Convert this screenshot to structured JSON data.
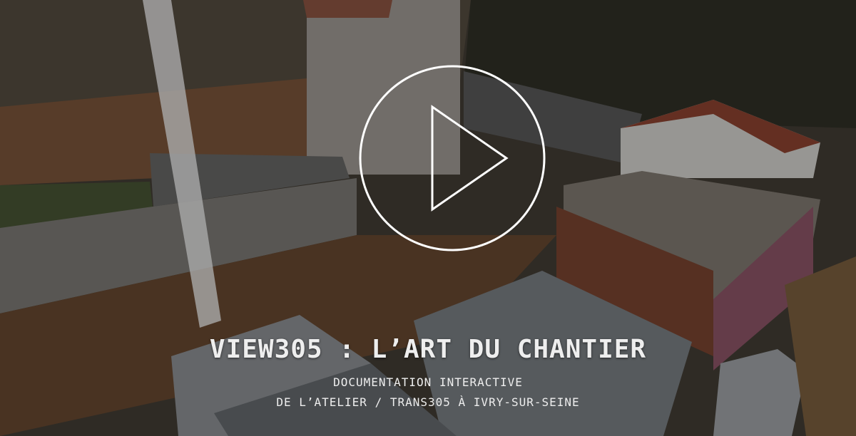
{
  "video": {
    "title": "VIEW305 : L’ART DU CHANTIER",
    "subtitle_line1": "DOCUMENTATION INTERACTIVE",
    "subtitle_line2": "DE L’ATELIER / TRANS305 À IVRY-SUR-SEINE",
    "play_icon": "play-icon",
    "background": "aerial photo of construction site"
  }
}
